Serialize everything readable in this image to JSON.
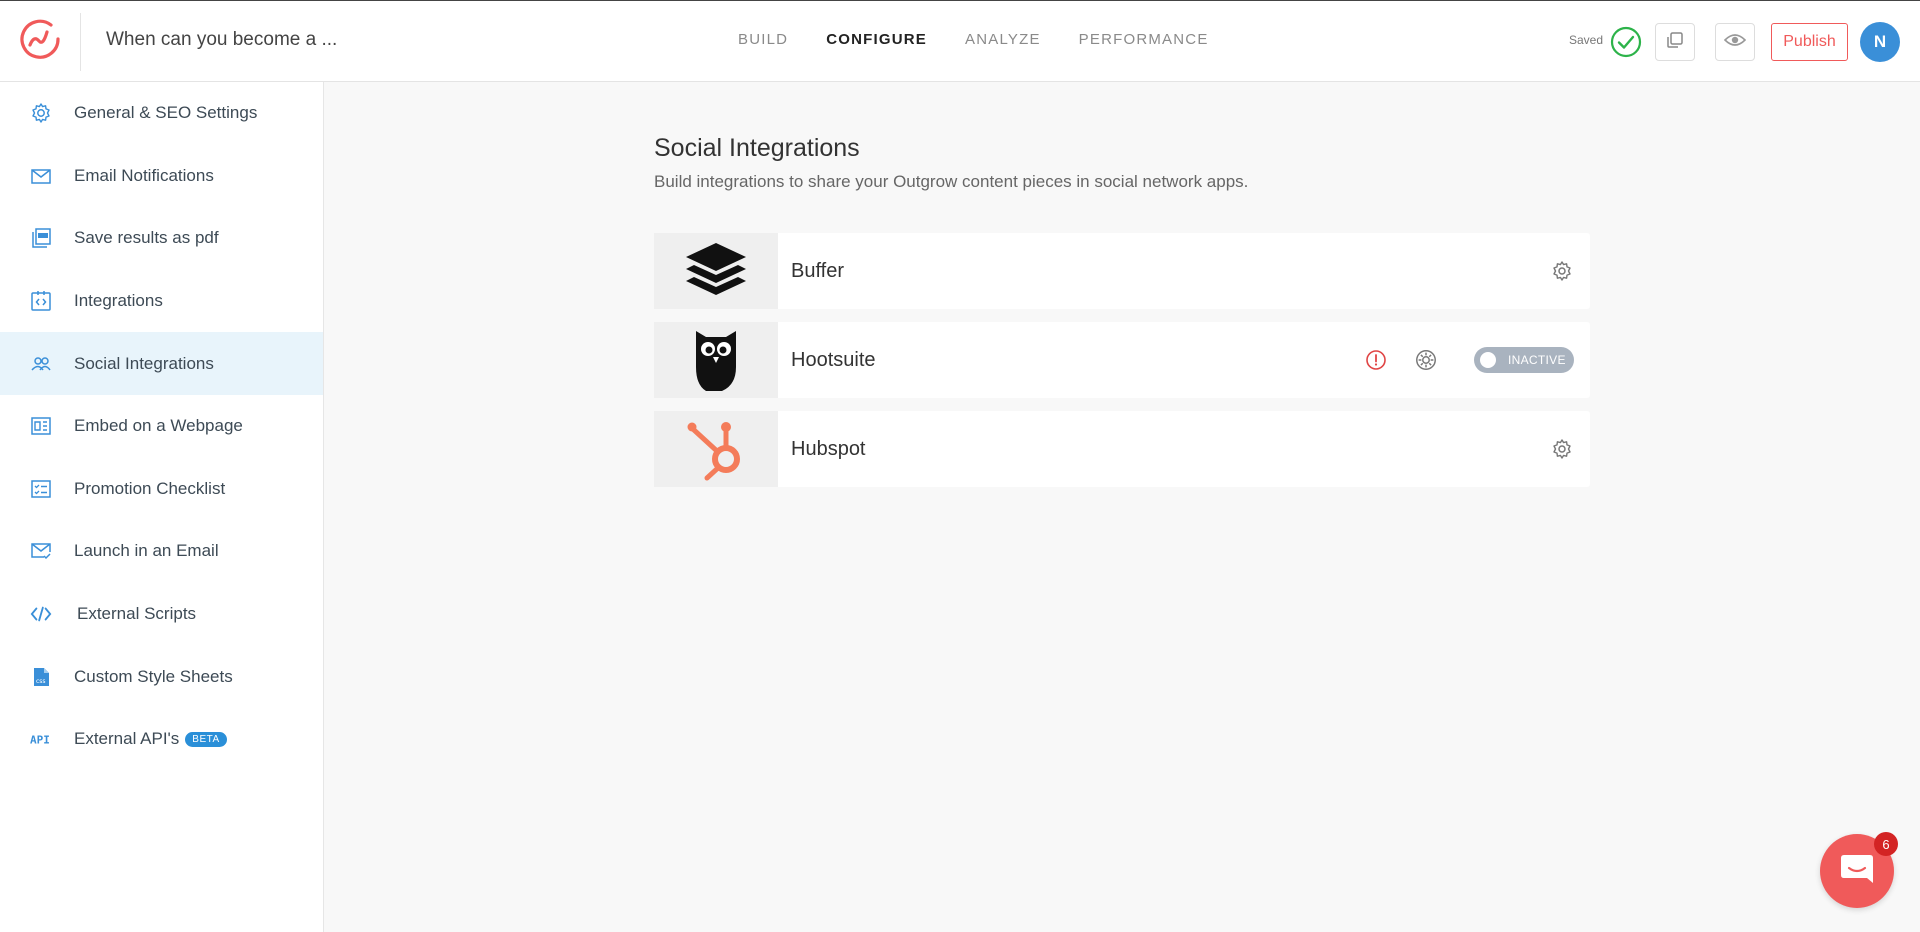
{
  "header": {
    "title": "When can you become a ...",
    "nav": [
      {
        "label": "BUILD",
        "active": false
      },
      {
        "label": "CONFIGURE",
        "active": true
      },
      {
        "label": "ANALYZE",
        "active": false
      },
      {
        "label": "PERFORMANCE",
        "active": false
      }
    ],
    "saved_label": "Saved",
    "publish_label": "Publish",
    "avatar_initial": "N"
  },
  "sidebar": {
    "items": [
      {
        "label": "General & SEO Settings",
        "icon": "gear-icon"
      },
      {
        "label": "Email Notifications",
        "icon": "envelope-icon"
      },
      {
        "label": "Save results as pdf",
        "icon": "pdf-icon"
      },
      {
        "label": "Integrations",
        "icon": "integrations-icon"
      },
      {
        "label": "Social Integrations",
        "icon": "users-icon",
        "active": true
      },
      {
        "label": "Embed on a Webpage",
        "icon": "embed-icon"
      },
      {
        "label": "Promotion Checklist",
        "icon": "checklist-icon"
      },
      {
        "label": "Launch in an Email",
        "icon": "email-check-icon"
      },
      {
        "label": "External Scripts",
        "icon": "code-icon"
      },
      {
        "label": "Custom Style Sheets",
        "icon": "css-file-icon"
      },
      {
        "label": "External API's",
        "icon": "api-icon",
        "badge": "BETA"
      }
    ]
  },
  "main": {
    "heading": "Social Integrations",
    "subheading": "Build integrations to share your Outgrow content pieces in social network apps.",
    "integrations": [
      {
        "name": "Buffer",
        "icon": "buffer-logo"
      },
      {
        "name": "Hootsuite",
        "icon": "hootsuite-owl-logo",
        "status": "INACTIVE"
      },
      {
        "name": "Hubspot",
        "icon": "hubspot-logo"
      }
    ]
  },
  "chat": {
    "unread_count": "6"
  },
  "colors": {
    "accent": "#f05a5a",
    "primary": "#3a8fd8",
    "active_bg": "#e8f4fb",
    "toggle_inactive": "#a9b3bf"
  }
}
